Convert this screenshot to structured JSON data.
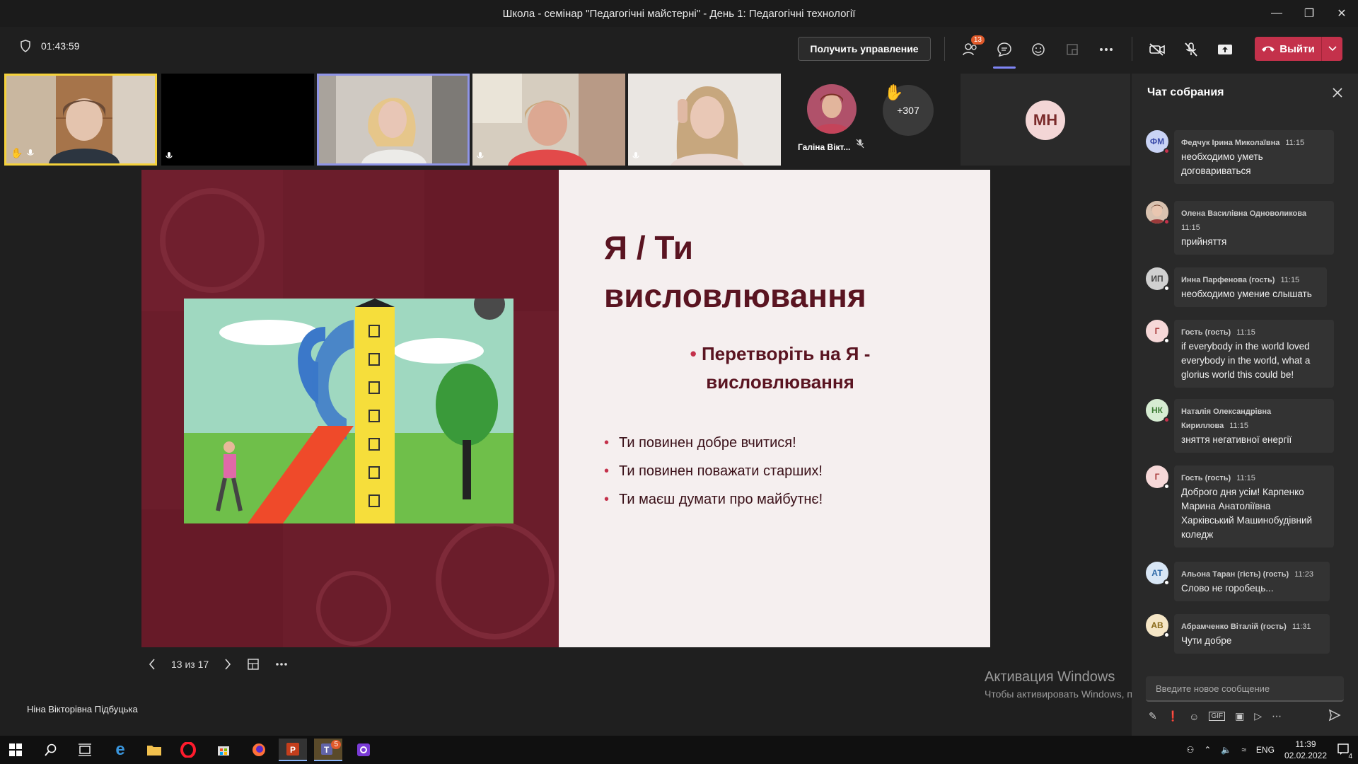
{
  "window": {
    "title": "Школа - семінар \"Педагогічні майстерні\" - День 1: Педагогічні технології"
  },
  "toolbar": {
    "timer": "01:43:59",
    "take_control": "Получить управление",
    "participants_badge": "13",
    "leave": "Выйти"
  },
  "participants": {
    "galina_label": "Галіна Вікт...",
    "overflow_count": "+307",
    "mh_initials": "МН"
  },
  "slide": {
    "title_line1": "Я / Ти",
    "title_line2": "висловлювання",
    "subtitle_line1": "Перетворіть на Я -",
    "subtitle_line2": "висловлювання",
    "bullets": [
      "Ти повинен добре вчитися!",
      "Ти повинен поважати старших!",
      "Ти маєш думати про майбутнє!"
    ]
  },
  "slide_nav": {
    "page": "13 из 17"
  },
  "presenter": "Ніна Вікторівна Підбуцька",
  "activation": {
    "line1": "Активация Windows",
    "line2": "Чтобы активировать Windows, перейдите в раздел \"Параметры\"."
  },
  "chat": {
    "title": "Чат собрания",
    "compose_placeholder": "Введите новое сообщение",
    "messages": [
      {
        "initials": "ФМ",
        "name": "Федчук Ірина Миколаївна",
        "time": "11:15",
        "text": "необходимо уметь договариваться",
        "avatar_bg": "#c9d3f5",
        "avatar_fg": "#3a4aa8"
      },
      {
        "initials": "",
        "name": "Олена Василівна Одноволикова",
        "time": "11:15",
        "text": "прийняття",
        "avatar_bg": "#b78a6e",
        "avatar_fg": "#fff"
      },
      {
        "initials": "ИП",
        "name": "Инна Парфенова (гость)",
        "time": "11:15",
        "text": "необходимо умение слышать",
        "avatar_bg": "#d0d0d0",
        "avatar_fg": "#444"
      },
      {
        "initials": "Г",
        "name": "Гость (гость)",
        "time": "11:15",
        "text": "if everybody in the world loved everybody in the world, what a glorius world this could be!",
        "avatar_bg": "#f6d8d8",
        "avatar_fg": "#a83a3a"
      },
      {
        "initials": "НК",
        "name": "Наталія Олександрівна Кириллова",
        "time": "11:15",
        "text": "зняття негативної енергії",
        "avatar_bg": "#d6ecd2",
        "avatar_fg": "#3b7a33"
      },
      {
        "initials": "Г",
        "name": "Гость (гость)",
        "time": "11:15",
        "text": "Доброго дня усім!  Карпенко Марина Анатоліївна Харківський Машинобудівний коледж",
        "avatar_bg": "#f6d8d8",
        "avatar_fg": "#a83a3a"
      },
      {
        "initials": "АТ",
        "name": "Альона Таран (гість) (гость)",
        "time": "11:23",
        "text": "Слово не горобець...",
        "avatar_bg": "#d8e6f5",
        "avatar_fg": "#2f6aa8"
      },
      {
        "initials": "АВ",
        "name": "Абрамченко Віталій (гость)",
        "time": "11:31",
        "text": "Чути добре",
        "avatar_bg": "#f5e6c6",
        "avatar_fg": "#8a6a1a"
      }
    ]
  },
  "taskbar": {
    "lang": "ENG",
    "time": "11:39",
    "date": "02.02.2022",
    "teams_badge": "5",
    "notif_badge": "4"
  }
}
